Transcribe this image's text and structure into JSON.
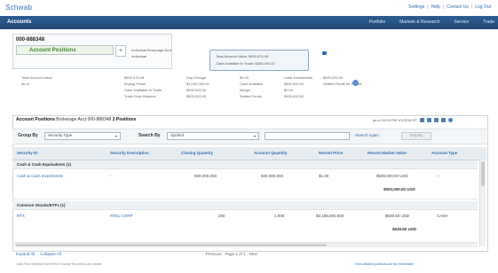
{
  "header": {
    "logo": "Schwab",
    "links": [
      "Settings",
      "Help",
      "Contact Us",
      "Log Out"
    ]
  },
  "nav": {
    "brand": "Accounts",
    "menu": [
      "Portfolio",
      "Markets & Research",
      "Service",
      "Trade"
    ]
  },
  "account": {
    "number": "000-888348",
    "selector": "Account Positions",
    "add": "+",
    "meta": [
      "Individual Brokerage Acct",
      "Individual"
    ],
    "balance_lines": [
      "Total Account Value: $500,676.98",
      "Cash Available to Trade: $500,000.00"
    ]
  },
  "summary": {
    "lines": [
      [
        "Total Account Value",
        "$500,676.98",
        "Day Change",
        "$0.00",
        "Cash Investments",
        "$500,000.00"
      ],
      [
        "as of",
        "Buying Power",
        "$1,000,000.00",
        "Cash Available",
        "$500,000.00",
        ""
      ],
      [
        "",
        "Cash Available to Trade",
        "$500,000.00",
        "Margin",
        "$0.00",
        ""
      ],
      [
        "",
        "Trade Date Balance",
        "$500,000.00",
        "Settled Funds",
        "$500,000.00",
        "Settled Funds for Trades"
      ]
    ]
  },
  "positions": {
    "title": "Account Positions",
    "subtitle": "Brokerage Acct 000-888348",
    "count": "2 Positions",
    "as_of": "as of 03:44 PM 1/1/2016 ET",
    "group_by_label": "Group By",
    "group_by_value": "Security Type",
    "search_label": "Search By",
    "search_value": "Symbol",
    "search_placeholder": "",
    "search_link": "Search Again",
    "display_btn": "Display",
    "columns": [
      "Security ID",
      "Security Description",
      "Closing Quantity",
      "Account Quantity",
      "Recent Price",
      "Recent Market Value",
      "Account Type"
    ],
    "groups": [
      {
        "name": "Cash & Cash Equivalents (1)",
        "rows": [
          [
            "Cash & Cash Investments",
            "--",
            "500,000.000",
            "500,000.000",
            "$1.00",
            "$500,000.00 USD",
            "--"
          ]
        ],
        "total": "$500,000.00 USD"
      },
      {
        "name": "Common Stocks/ETFs (1)",
        "rows": [
          [
            "RTX",
            "RTEL CORP",
            "200",
            "1.000",
            "$3,188,000.000",
            "$638.60 USD",
            "CASH"
          ]
        ],
        "total": "$638.60 USD"
      }
    ],
    "footer_links": [
      "Expand All",
      "Collapse All"
    ],
    "pagination": [
      "Previous",
      "Page 1 of 1",
      "Next"
    ],
    "legend": "Cash Flow  Material Event  Price Change  Rounded  Last update",
    "footnote": "View detailed positions and tax information"
  }
}
